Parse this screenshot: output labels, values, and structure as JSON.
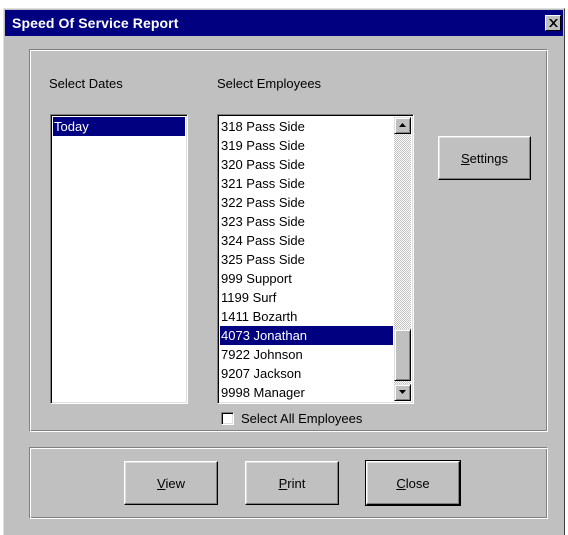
{
  "window": {
    "title": "Speed Of Service Report",
    "close_icon": "close-x-icon"
  },
  "dates": {
    "label": "Select Dates",
    "items": [
      "Today"
    ],
    "selected_index": 0
  },
  "employees": {
    "label": "Select Employees",
    "items": [
      "318  Pass Side",
      "319  Pass Side",
      "320  Pass Side",
      "321  Pass Side",
      "322  Pass Side",
      "323  Pass Side",
      "324  Pass Side",
      "325  Pass Side",
      "999  Support",
      "1199  Surf",
      "1411  Bozarth",
      "4073  Jonathan",
      "7922  Johnson",
      "9207  Jackson",
      "9998  Manager"
    ],
    "selected_index": 11,
    "select_all_label": "Select All Employees",
    "select_all_checked": false
  },
  "buttons": {
    "settings": {
      "mnemonic": "S",
      "rest": "ettings"
    },
    "view": {
      "mnemonic": "V",
      "rest": "iew"
    },
    "print": {
      "mnemonic": "P",
      "rest": "rint"
    },
    "close": {
      "mnemonic": "C",
      "rest": "lose"
    }
  },
  "colors": {
    "title_bar": "#000080",
    "selection": "#000080",
    "face": "#c0c0c0"
  }
}
